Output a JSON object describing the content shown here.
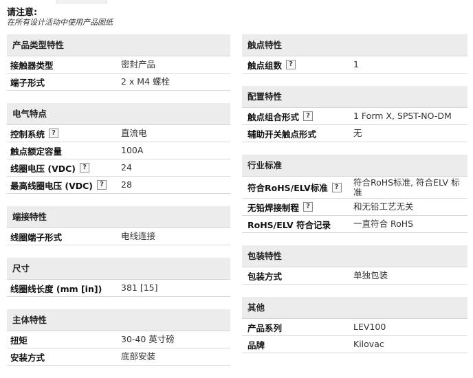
{
  "note": {
    "title": "请注意:",
    "subtitle": "在所有设计活动中使用产品图纸"
  },
  "left_sections": [
    {
      "title": "产品类型特性",
      "rows": [
        {
          "label": "接触器类型",
          "value": "密封产品",
          "help": false
        },
        {
          "label": "端子形式",
          "value": "2 x M4 螺栓",
          "help": false
        }
      ]
    },
    {
      "title": "电气特点",
      "rows": [
        {
          "label": "控制系统",
          "value": "直流电",
          "help": true
        },
        {
          "label": "触点额定容量",
          "value": "100A",
          "help": false
        },
        {
          "label": "线圈电压 (VDC)",
          "value": "24",
          "help": true
        },
        {
          "label": "最高线圈电压 (VDC)",
          "value": "28",
          "help": true
        }
      ]
    },
    {
      "title": "端接特性",
      "rows": [
        {
          "label": "线圈端子形式",
          "value": "电线连接",
          "help": false
        }
      ]
    },
    {
      "title": "尺寸",
      "rows": [
        {
          "label": "线圈线长度 (mm [in])",
          "value": "381 [15]",
          "help": false
        }
      ]
    },
    {
      "title": "主体特性",
      "rows": [
        {
          "label": "扭矩",
          "value": "30-40 英寸磅",
          "help": false
        },
        {
          "label": "安装方式",
          "value": "底部安装",
          "help": false
        }
      ]
    }
  ],
  "right_sections": [
    {
      "title": "触点特性",
      "rows": [
        {
          "label": "触点组数",
          "value": "1",
          "help": true
        }
      ]
    },
    {
      "title": "配置特性",
      "rows": [
        {
          "label": "触点组合形式",
          "value": "1 Form X, SPST-NO-DM",
          "help": true
        },
        {
          "label": "辅助开关触点形式",
          "value": "无",
          "help": false
        }
      ]
    },
    {
      "title": "行业标准",
      "rows": [
        {
          "label": "符合RoHS/ELV标准",
          "value": "符合RoHS标准, 符合ELV 标准",
          "help": true,
          "tall": true
        },
        {
          "label": "无铅焊接制程",
          "value": "和无铅工艺无关",
          "help": true
        },
        {
          "label": "RoHS/ELV 符合记录",
          "value": "一直符合 RoHS",
          "help": false
        }
      ]
    },
    {
      "title": "包装特性",
      "rows": [
        {
          "label": "包装方式",
          "value": "单独包装",
          "help": false
        }
      ]
    },
    {
      "title": "其他",
      "rows": [
        {
          "label": "产品系列",
          "value": "LEV100",
          "help": false
        },
        {
          "label": "品牌",
          "value": "Kilovac",
          "help": false
        }
      ]
    }
  ],
  "help_icon": {
    "name": "help-icon",
    "glyph": "?"
  }
}
